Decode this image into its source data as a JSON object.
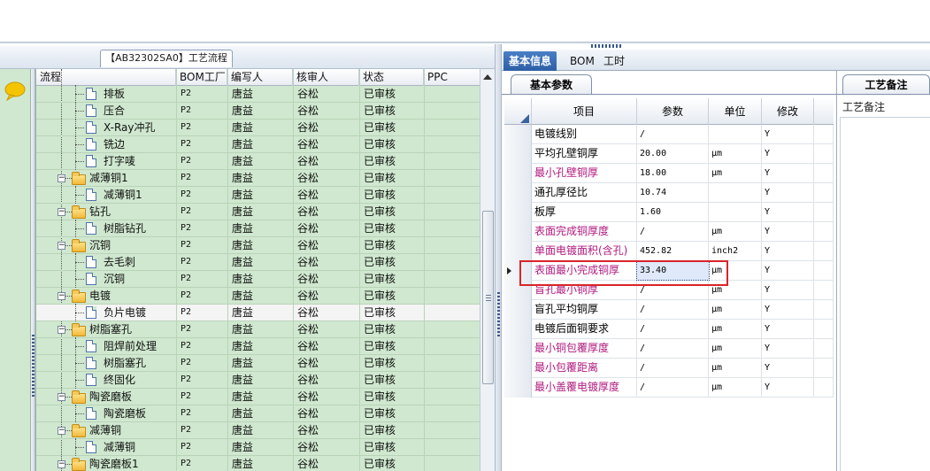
{
  "process_panel": {
    "title": "【AB32302SA0】工艺流程",
    "columns": [
      "流程",
      "BOM工厂",
      "编写人",
      "核审人",
      "状态",
      "PPC"
    ],
    "rows": [
      {
        "name": "排板",
        "level": 2,
        "type": "doc",
        "factory": "P2",
        "writer": "唐益",
        "reviewer": "谷松",
        "status": "已审核"
      },
      {
        "name": "压合",
        "level": 2,
        "type": "doc",
        "factory": "P2",
        "writer": "唐益",
        "reviewer": "谷松",
        "status": "已审核"
      },
      {
        "name": "X-Ray冲孔",
        "level": 2,
        "type": "doc",
        "factory": "P2",
        "writer": "唐益",
        "reviewer": "谷松",
        "status": "已审核"
      },
      {
        "name": "铣边",
        "level": 2,
        "type": "doc",
        "factory": "P2",
        "writer": "唐益",
        "reviewer": "谷松",
        "status": "已审核"
      },
      {
        "name": "打字唛",
        "level": 2,
        "type": "doc",
        "factory": "P2",
        "writer": "唐益",
        "reviewer": "谷松",
        "status": "已审核"
      },
      {
        "name": "减薄铜1",
        "level": 1,
        "type": "folder",
        "factory": "P2",
        "writer": "唐益",
        "reviewer": "谷松",
        "status": "已审核"
      },
      {
        "name": "减薄铜1",
        "level": 2,
        "type": "doc",
        "factory": "P2",
        "writer": "唐益",
        "reviewer": "谷松",
        "status": "已审核"
      },
      {
        "name": "钻孔",
        "level": 1,
        "type": "folder",
        "factory": "P2",
        "writer": "唐益",
        "reviewer": "谷松",
        "status": "已审核"
      },
      {
        "name": "树脂钻孔",
        "level": 2,
        "type": "doc",
        "factory": "P2",
        "writer": "唐益",
        "reviewer": "谷松",
        "status": "已审核"
      },
      {
        "name": "沉铜",
        "level": 1,
        "type": "folder",
        "factory": "P2",
        "writer": "唐益",
        "reviewer": "谷松",
        "status": "已审核"
      },
      {
        "name": "去毛刺",
        "level": 2,
        "type": "doc",
        "factory": "P2",
        "writer": "唐益",
        "reviewer": "谷松",
        "status": "已审核"
      },
      {
        "name": "沉铜",
        "level": 2,
        "type": "doc",
        "factory": "P2",
        "writer": "唐益",
        "reviewer": "谷松",
        "status": "已审核"
      },
      {
        "name": "电镀",
        "level": 1,
        "type": "folder",
        "factory": "P2",
        "writer": "唐益",
        "reviewer": "谷松",
        "status": "已审核"
      },
      {
        "name": "负片电镀",
        "level": 2,
        "type": "doc",
        "factory": "P2",
        "writer": "唐益",
        "reviewer": "谷松",
        "status": "已审核",
        "selected": true
      },
      {
        "name": "树脂塞孔",
        "level": 1,
        "type": "folder",
        "factory": "P2",
        "writer": "唐益",
        "reviewer": "谷松",
        "status": "已审核"
      },
      {
        "name": "阻焊前处理",
        "level": 2,
        "type": "doc",
        "factory": "P2",
        "writer": "唐益",
        "reviewer": "谷松",
        "status": "已审核"
      },
      {
        "name": "树脂塞孔",
        "level": 2,
        "type": "doc",
        "factory": "P2",
        "writer": "唐益",
        "reviewer": "谷松",
        "status": "已审核"
      },
      {
        "name": "终固化",
        "level": 2,
        "type": "doc",
        "factory": "P2",
        "writer": "唐益",
        "reviewer": "谷松",
        "status": "已审核"
      },
      {
        "name": "陶瓷磨板",
        "level": 1,
        "type": "folder",
        "factory": "P2",
        "writer": "唐益",
        "reviewer": "谷松",
        "status": "已审核"
      },
      {
        "name": "陶瓷磨板",
        "level": 2,
        "type": "doc",
        "factory": "P2",
        "writer": "唐益",
        "reviewer": "谷松",
        "status": "已审核"
      },
      {
        "name": "减薄铜",
        "level": 1,
        "type": "folder",
        "factory": "P2",
        "writer": "唐益",
        "reviewer": "谷松",
        "status": "已审核"
      },
      {
        "name": "减薄铜",
        "level": 2,
        "type": "doc",
        "factory": "P2",
        "writer": "唐益",
        "reviewer": "谷松",
        "status": "已审核"
      },
      {
        "name": "陶瓷磨板1",
        "level": 1,
        "type": "folder",
        "factory": "P2",
        "writer": "唐益",
        "reviewer": "谷松",
        "status": "已审核"
      }
    ]
  },
  "info_panel": {
    "tabs": [
      "基本信息",
      "BOM",
      "工时"
    ],
    "active_tab": "基本信息",
    "subtab": "基本参数",
    "columns": [
      "项目",
      "参数",
      "单位",
      "修改"
    ],
    "rows": [
      {
        "item": "电镀线别",
        "value": "/",
        "unit": "",
        "mod": "Y",
        "pink": false
      },
      {
        "item": "平均孔壁铜厚",
        "value": "20.00",
        "unit": "μm",
        "mod": "Y",
        "pink": false
      },
      {
        "item": "最小孔壁铜厚",
        "value": "18.00",
        "unit": "μm",
        "mod": "Y",
        "pink": true
      },
      {
        "item": "通孔厚径比",
        "value": "10.74",
        "unit": "",
        "mod": "Y",
        "pink": false
      },
      {
        "item": "板厚",
        "value": "1.60",
        "unit": "",
        "mod": "Y",
        "pink": false
      },
      {
        "item": "表面完成铜厚度",
        "value": "/",
        "unit": "μm",
        "mod": "Y",
        "pink": true
      },
      {
        "item": "单面电镀面积(含孔)",
        "value": "452.82",
        "unit": "inch2",
        "mod": "Y",
        "pink": true
      },
      {
        "item": "表面最小完成铜厚",
        "value": "33.40",
        "unit": "μm",
        "mod": "Y",
        "pink": true,
        "current": true
      },
      {
        "item": "盲孔最小铜厚",
        "value": "/",
        "unit": "μm",
        "mod": "Y",
        "pink": true
      },
      {
        "item": "盲孔平均铜厚",
        "value": "/",
        "unit": "μm",
        "mod": "Y",
        "pink": false
      },
      {
        "item": "电镀后面铜要求",
        "value": "/",
        "unit": "μm",
        "mod": "Y",
        "pink": false
      },
      {
        "item": "最小铜包覆厚度",
        "value": "/",
        "unit": "μm",
        "mod": "Y",
        "pink": true
      },
      {
        "item": "最小包覆距离",
        "value": "/",
        "unit": "μm",
        "mod": "Y",
        "pink": true
      },
      {
        "item": "最小盖覆电镀厚度",
        "value": "/",
        "unit": "μm",
        "mod": "Y",
        "pink": true
      }
    ]
  },
  "remark_panel": {
    "tab": "工艺备注",
    "label": "工艺备注"
  },
  "colors": {
    "grid_bg": "#cfe8cf",
    "active_tab": "#2d5fa6",
    "pink_text": "#b0197d",
    "highlight_box": "#d9242a"
  },
  "icons": [
    "chat-bubble-icon",
    "folder-icon",
    "document-icon",
    "collapse-icon",
    "scroll-up-icon",
    "row-pointer-icon"
  ]
}
